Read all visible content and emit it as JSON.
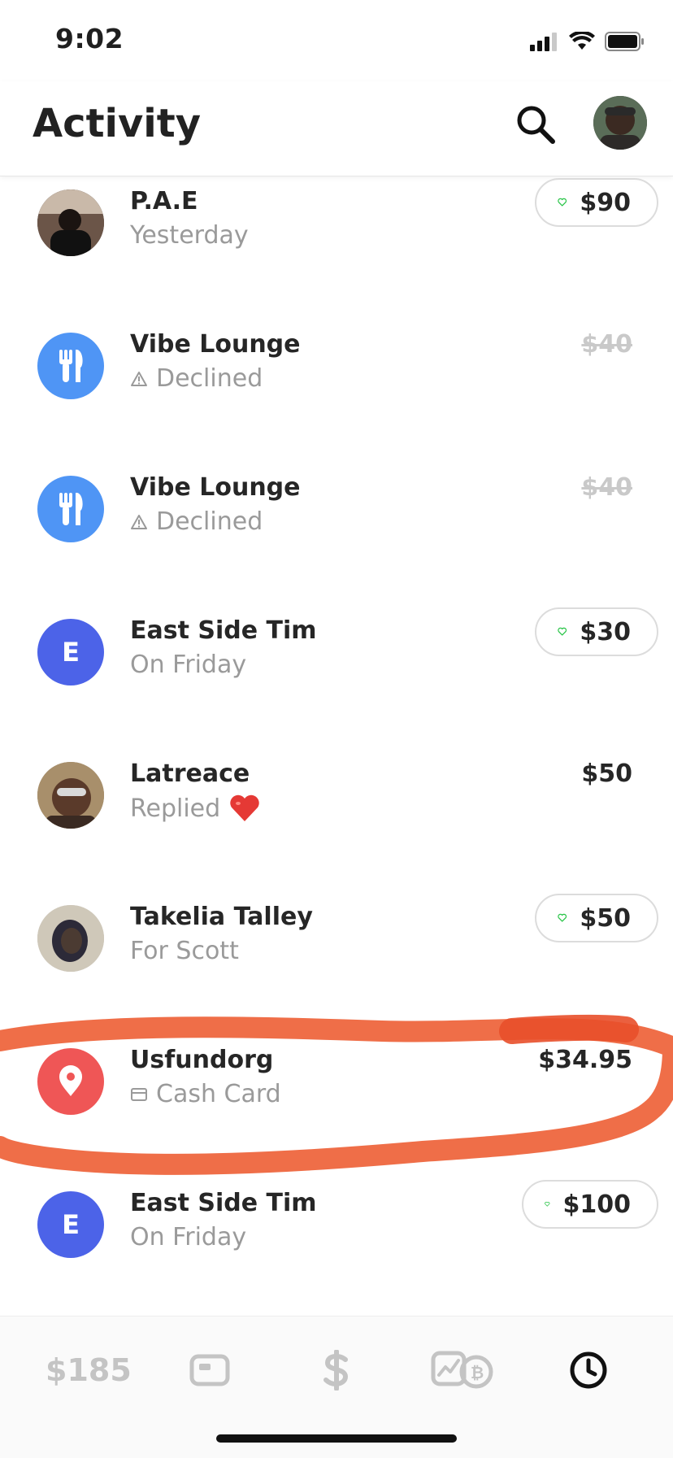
{
  "status_bar": {
    "time": "9:02"
  },
  "header": {
    "title": "Activity"
  },
  "colors": {
    "accent_green": "#28c447",
    "blue_avatar": "#4f95f5",
    "indigo_avatar": "#4c63e8",
    "red_avatar": "#ef5656",
    "annotation": "#ee6238"
  },
  "activity": [
    {
      "name": "P.A.E",
      "subtitle": "Yesterday",
      "amount": "$90",
      "style": "liked",
      "avatar": "photo"
    },
    {
      "name": "Vibe Lounge",
      "subtitle": "Declined",
      "amount": "$40",
      "style": "declined",
      "avatar": "restaurant-icon"
    },
    {
      "name": "Vibe Lounge",
      "subtitle": "Declined",
      "amount": "$40",
      "style": "declined",
      "avatar": "restaurant-icon"
    },
    {
      "name": "East Side Tim",
      "subtitle": "On Friday",
      "amount": "$30",
      "style": "liked",
      "avatar_letter": "E"
    },
    {
      "name": "Latreace",
      "subtitle": "Replied",
      "amount": "$50",
      "style": "plain",
      "avatar": "photo",
      "reaction": "heart"
    },
    {
      "name": "Takelia Talley",
      "subtitle": "For Scott",
      "amount": "$50",
      "style": "liked",
      "avatar": "photo"
    },
    {
      "name": "Usfundorg",
      "subtitle": "Cash Card",
      "amount": "$34.95",
      "style": "plain",
      "avatar": "location-pin-icon"
    },
    {
      "name": "East Side Tim",
      "subtitle": "On Friday",
      "amount": "$100",
      "style": "liked",
      "avatar_letter": "E"
    }
  ],
  "tabbar": {
    "balance": "$185"
  }
}
